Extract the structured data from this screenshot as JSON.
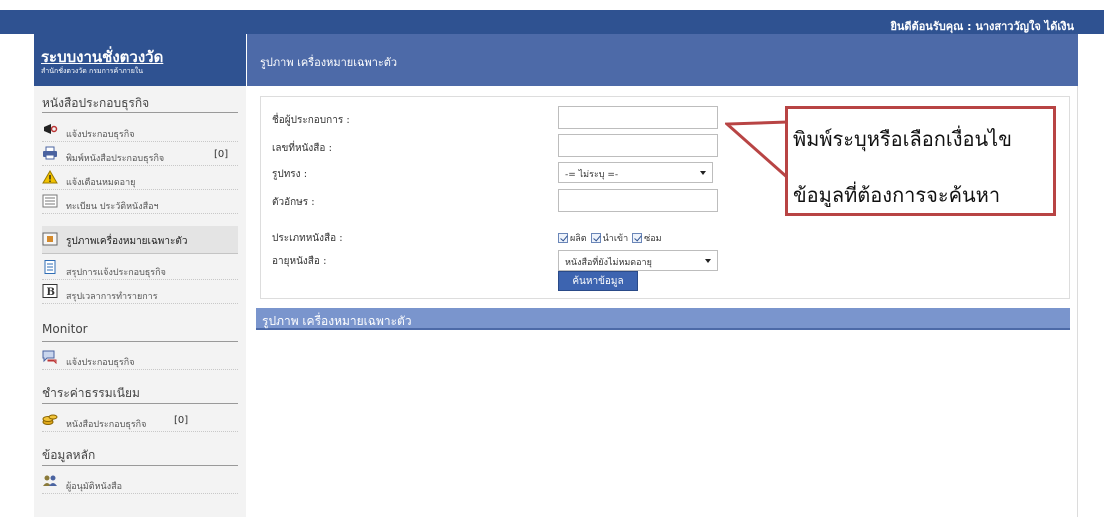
{
  "topbar": {
    "welcome": "ยินดีต้อนรับคุณ : นางสาววัญใจ ได้เงิน"
  },
  "brand": {
    "title": "ระบบงานชั่งตวงวัด",
    "subtitle": "สำนักชั่งตวงวัด กรมการค้าภายใน"
  },
  "page": {
    "title": "รูปภาพ เครื่องหมายเฉพาะตัว"
  },
  "sidebar": {
    "sections": [
      {
        "title": "หนังสือประกอบธุรกิจ"
      },
      {
        "title": "Monitor"
      },
      {
        "title": "ชำระค่าธรรมเนียม"
      },
      {
        "title": "ข้อมูลหลัก"
      }
    ],
    "items": [
      {
        "label": "แจ้งประกอบธุรกิจ",
        "icon": "megaphone-icon"
      },
      {
        "label": "พิมพ์หนังสือประกอบธุรกิจ",
        "count": "[0]",
        "icon": "printer-icon"
      },
      {
        "label": "แจ้งเตือนหมดอายุ",
        "icon": "warning-icon"
      },
      {
        "label": "ทะเบียน ประวัติหนังสือฯ",
        "icon": "register-icon"
      },
      {
        "label": "รูปภาพเครื่องหมายเฉพาะตัว",
        "icon": "picture-icon"
      },
      {
        "label": "สรุปการแจ้งประกอบธุรกิจ",
        "icon": "document-icon"
      },
      {
        "label": "สรุปเวลาการทำรายการ",
        "icon": "b-icon"
      },
      {
        "label": "แจ้งประกอบธุรกิจ",
        "icon": "chat-icon"
      },
      {
        "label": "หนังสือประกอบธุรกิจ",
        "count": "[0]",
        "icon": "coins-icon"
      },
      {
        "label": "ผู้อนุมัติหนังสือ",
        "icon": "users-icon"
      }
    ]
  },
  "form": {
    "operator_name": {
      "label": "ชื่อผู้ประกอบการ :",
      "value": ""
    },
    "book_no": {
      "label": "เลขที่หนังสือ :",
      "value": ""
    },
    "shape": {
      "label": "รูปทรง :",
      "selected": "-= ไม่ระบุ =-"
    },
    "letters": {
      "label": "ตัวอักษร :",
      "value": ""
    },
    "book_type": {
      "label": "ประเภทหนังสือ :",
      "options": [
        {
          "label": "ผลิต",
          "checked": true
        },
        {
          "label": "นำเข้า",
          "checked": true
        },
        {
          "label": "ซ่อม",
          "checked": true
        }
      ]
    },
    "book_age": {
      "label": "อายุหนังสือ :",
      "selected": "หนังสือที่ยังไม่หมดอายุ"
    },
    "search_button": "ค้นหาข้อมูล"
  },
  "results": {
    "title": "รูปภาพ เครื่องหมายเฉพาะตัว"
  },
  "callout": {
    "line1": "พิมพ์ระบุหรือเลือกเงื่อนไข",
    "line2": "ข้อมูลที่ต้องการจะค้นหา"
  },
  "colors": {
    "primary": "#2f5291",
    "header": "#4d6aa8",
    "result_bar": "#7a95cd",
    "callout_border": "#b84444"
  }
}
